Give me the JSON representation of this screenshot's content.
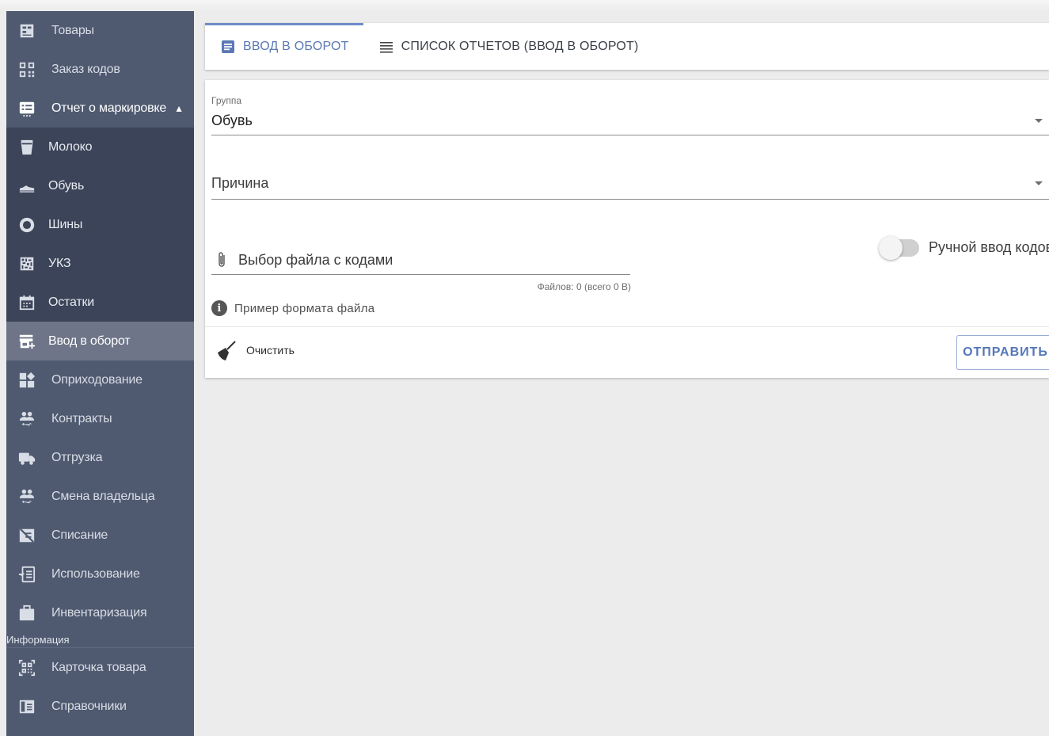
{
  "sidebar": {
    "items": [
      {
        "label": "Товары",
        "icon": "products-icon"
      },
      {
        "label": "Заказ кодов",
        "icon": "qr-order-icon"
      },
      {
        "label": "Отчет о маркировке",
        "icon": "report-icon",
        "expanded": true
      },
      {
        "label": "Молоко",
        "icon": "milk-icon"
      },
      {
        "label": "Обувь",
        "icon": "shoe-icon"
      },
      {
        "label": "Шины",
        "icon": "tire-icon"
      },
      {
        "label": "УКЗ",
        "icon": "datamatrix-icon"
      },
      {
        "label": "Остатки",
        "icon": "calendar-icon"
      },
      {
        "label": "Ввод в оборот",
        "icon": "store-add-icon",
        "active": true
      },
      {
        "label": "Оприходование",
        "icon": "dashboard-icon"
      },
      {
        "label": "Контракты",
        "icon": "people-swap-icon"
      },
      {
        "label": "Отгрузка",
        "icon": "truck-icon"
      },
      {
        "label": "Смена владельца",
        "icon": "people-swap-icon"
      },
      {
        "label": "Списание",
        "icon": "write-off-icon"
      },
      {
        "label": "Использование",
        "icon": "input-icon"
      },
      {
        "label": "Инвентаризация",
        "icon": "briefcase-icon"
      }
    ],
    "section_label": "Информация",
    "info_items": [
      {
        "label": "Карточка товара",
        "icon": "qr-scan-icon"
      },
      {
        "label": "Справочники",
        "icon": "book-icon"
      }
    ],
    "chevron": "^"
  },
  "tabs": [
    {
      "label": "ВВОД В ОБОРОТ",
      "icon": "document-icon",
      "active": true
    },
    {
      "label": "СПИСОК ОТЧЕТОВ (ВВОД В ОБОРОТ)",
      "icon": "list-icon",
      "active": false
    }
  ],
  "form": {
    "group_label": "Группа",
    "group_value": "Обувь",
    "reason_placeholder": "Причина",
    "file_placeholder": "Выбор файла с кодами",
    "file_count": "Файлов: 0 (всего 0 B)",
    "example_link": "Пример формата файла",
    "manual_toggle_label": "Ручной ввод кодов",
    "manual_toggle_on": false,
    "clear_label": "Очистить",
    "send_label": "ОТПРАВИТЬ"
  },
  "colors": {
    "sidebar_bg": "#4f5a70",
    "sidebar_sub_bg": "#3b4458",
    "sidebar_active": "#6e7588",
    "accent": "#5b79b4"
  }
}
